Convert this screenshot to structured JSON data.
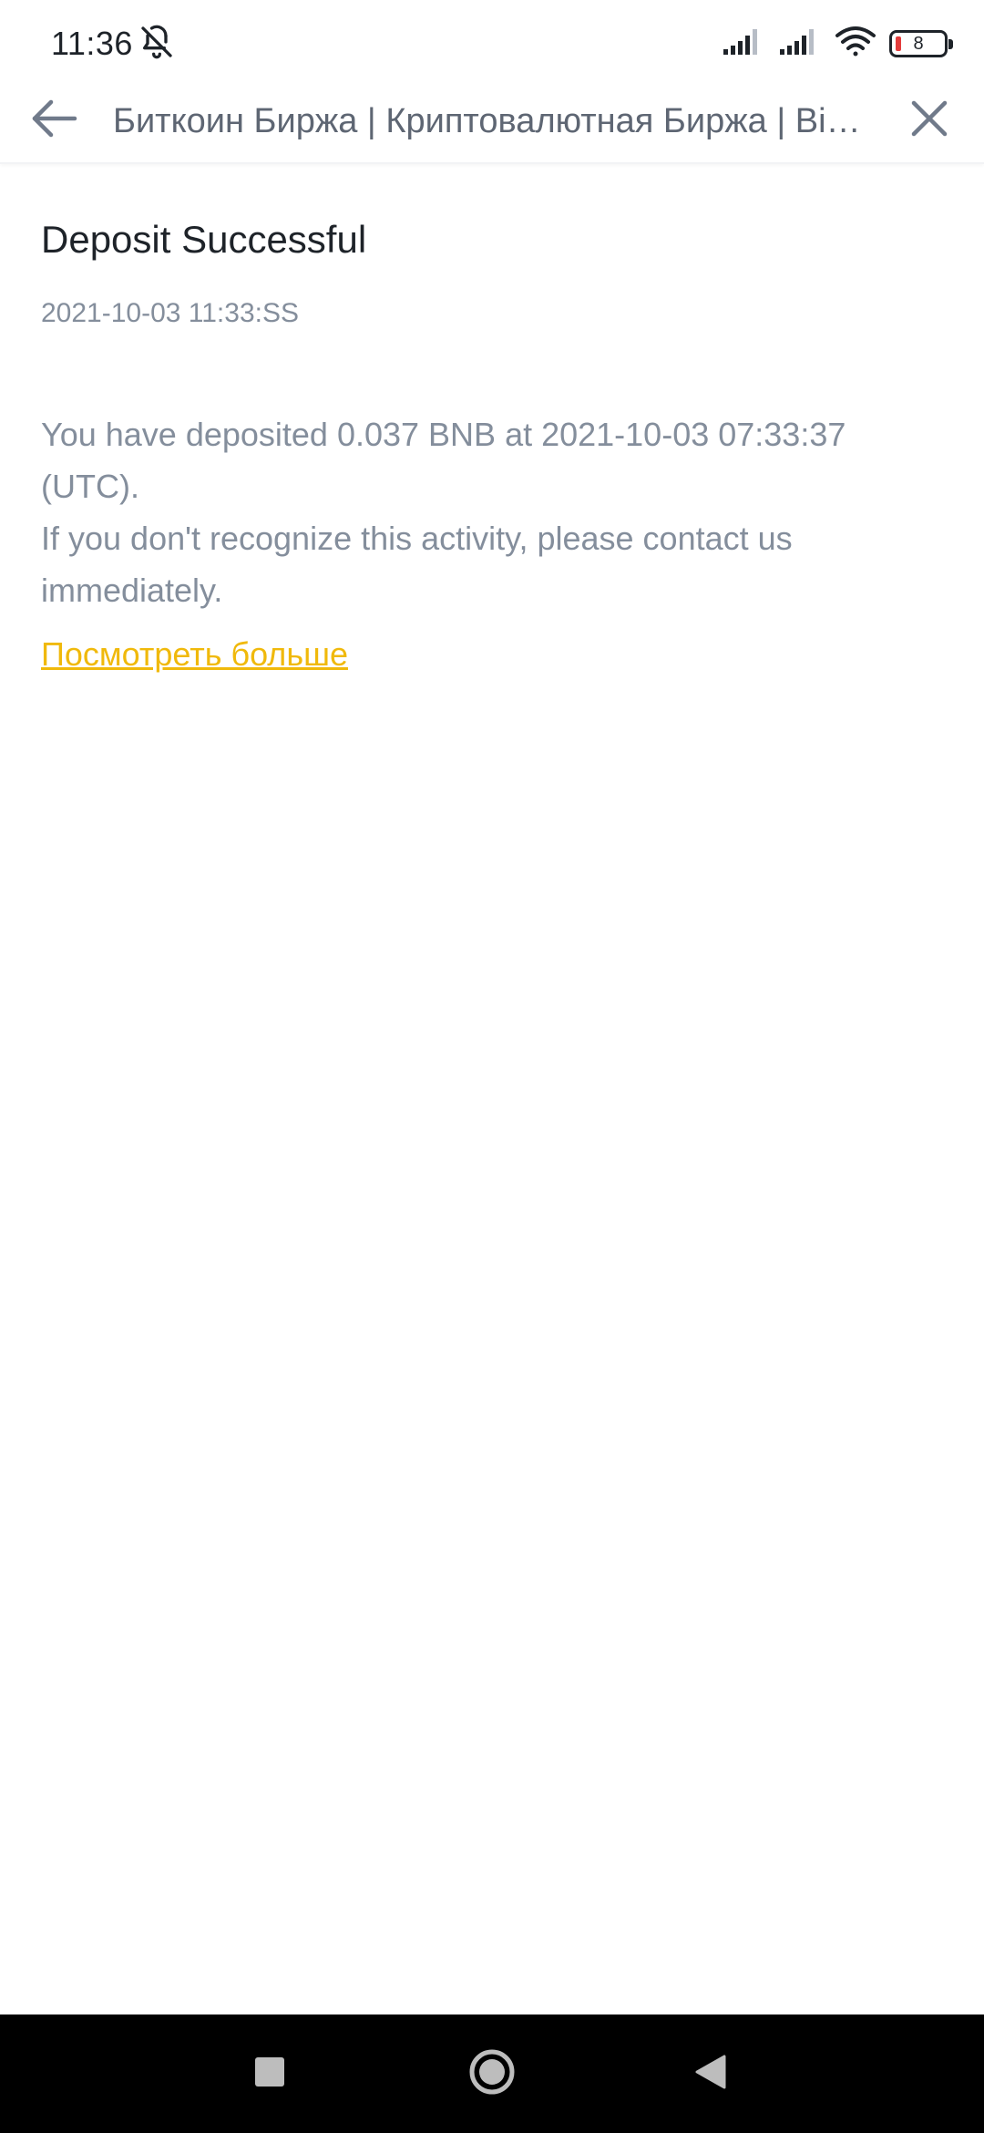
{
  "status_bar": {
    "time": "11:36",
    "battery_level": "8",
    "icons": [
      "bell-off-icon",
      "signal-icon",
      "signal-icon",
      "wifi-icon",
      "battery-icon"
    ]
  },
  "app_bar": {
    "title": "Биткоин Биржа | Криптовалютная Биржа | Binance",
    "back_icon": "back-arrow-icon",
    "close_icon": "close-icon"
  },
  "notice": {
    "title": "Deposit Successful",
    "date": "2021-10-03 11:33:SS",
    "body_line_1": "You have deposited 0.037 BNB at 2021-10-03 07:33:37 (UTC).",
    "body_line_2": "If you don't recognize this activity, please contact us immediately.",
    "view_more_label": "Посмотреть больше"
  },
  "nav_bar": {
    "icons": [
      "recents-square-icon",
      "home-circle-icon",
      "back-triangle-icon"
    ]
  },
  "colors": {
    "accent": "#f0b90b",
    "text_primary": "#1e2329",
    "text_secondary": "#848e9c",
    "title_gray": "#5e6673",
    "icon_gray": "#707a8a",
    "battery_low": "#e33c3c"
  }
}
